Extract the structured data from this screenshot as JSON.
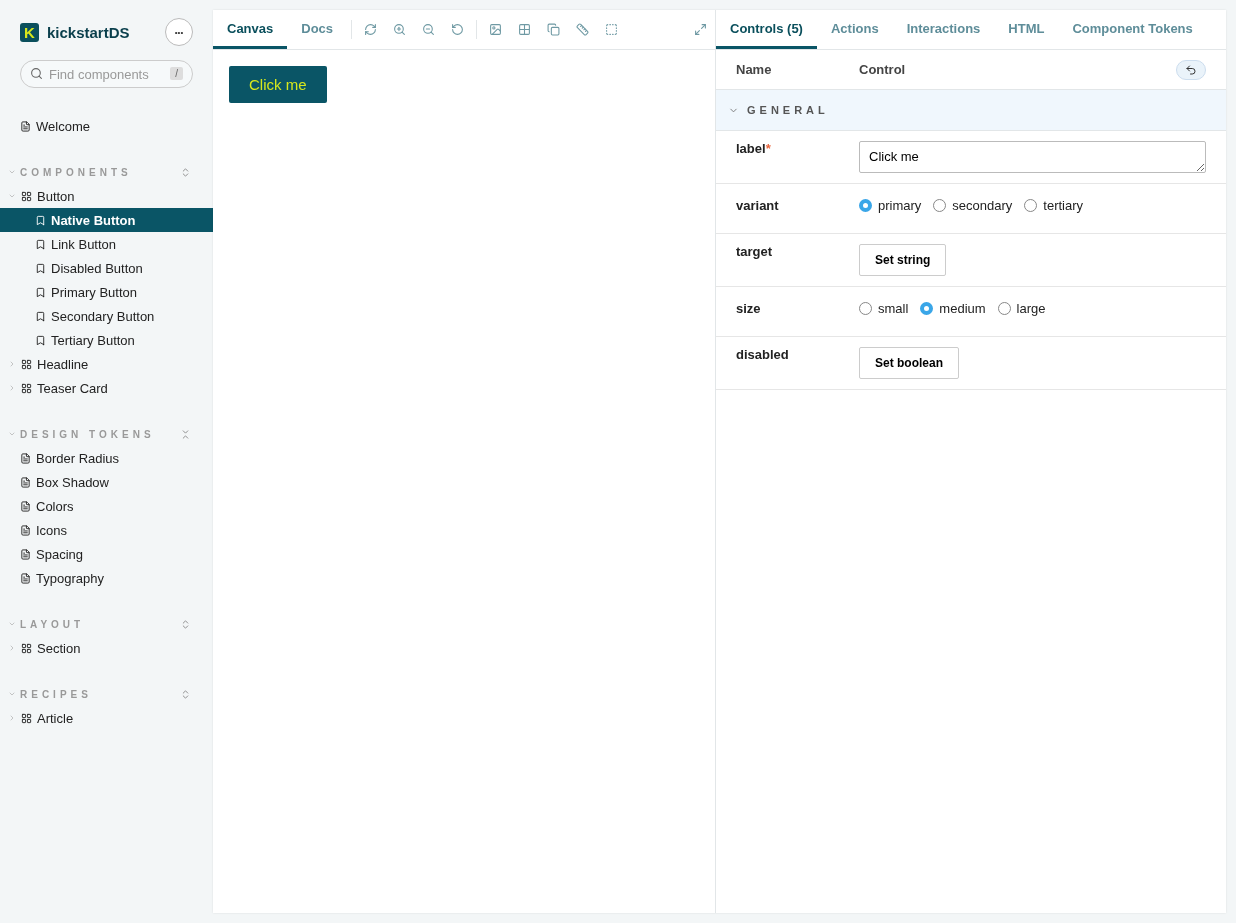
{
  "sidebar": {
    "logo_mark": "K",
    "brand": "kickstartDS",
    "menu_button": "•••",
    "search": {
      "placeholder": "Find components",
      "shortcut": "/"
    },
    "top_items": [
      {
        "label": "Welcome",
        "kind": "doc",
        "selected": false
      }
    ],
    "sections": [
      {
        "title": "COMPONENTS",
        "expanded": true,
        "all_expanded": false,
        "items": [
          {
            "label": "Button",
            "kind": "component",
            "expanded": true,
            "selected": false,
            "children": [
              {
                "label": "Native Button",
                "kind": "story",
                "selected": true
              },
              {
                "label": "Link Button",
                "kind": "story",
                "selected": false
              },
              {
                "label": "Disabled Button",
                "kind": "story",
                "selected": false
              },
              {
                "label": "Primary Button",
                "kind": "story",
                "selected": false
              },
              {
                "label": "Secondary Button",
                "kind": "story",
                "selected": false
              },
              {
                "label": "Tertiary Button",
                "kind": "story",
                "selected": false
              }
            ]
          },
          {
            "label": "Headline",
            "kind": "component",
            "expanded": false,
            "selected": false
          },
          {
            "label": "Teaser Card",
            "kind": "component",
            "expanded": false,
            "selected": false
          }
        ]
      },
      {
        "title": "DESIGN TOKENS",
        "expanded": true,
        "all_expanded": true,
        "items": [
          {
            "label": "Border Radius",
            "kind": "doc",
            "selected": false
          },
          {
            "label": "Box Shadow",
            "kind": "doc",
            "selected": false
          },
          {
            "label": "Colors",
            "kind": "doc",
            "selected": false
          },
          {
            "label": "Icons",
            "kind": "doc",
            "selected": false
          },
          {
            "label": "Spacing",
            "kind": "doc",
            "selected": false
          },
          {
            "label": "Typography",
            "kind": "doc",
            "selected": false
          }
        ]
      },
      {
        "title": "LAYOUT",
        "expanded": true,
        "all_expanded": false,
        "items": [
          {
            "label": "Section",
            "kind": "component",
            "expanded": false,
            "selected": false
          }
        ]
      },
      {
        "title": "RECIPES",
        "expanded": true,
        "all_expanded": false,
        "items": [
          {
            "label": "Article",
            "kind": "component",
            "expanded": false,
            "selected": false
          }
        ]
      }
    ]
  },
  "canvas": {
    "tabs": [
      {
        "label": "Canvas",
        "selected": true
      },
      {
        "label": "Docs",
        "selected": false
      }
    ],
    "preview_button": "Click me"
  },
  "addons": {
    "tabs": [
      {
        "label": "Controls (5)",
        "selected": true
      },
      {
        "label": "Actions",
        "selected": false
      },
      {
        "label": "Interactions",
        "selected": false
      },
      {
        "label": "HTML",
        "selected": false
      },
      {
        "label": "Component Tokens",
        "selected": false
      }
    ],
    "columns": [
      "Name",
      "Control"
    ],
    "group": {
      "title": "GENERAL",
      "expanded": true
    },
    "rows": [
      {
        "name": "label",
        "required": true,
        "required_mark": "*",
        "kind": "text",
        "value": "Click me"
      },
      {
        "name": "variant",
        "required": false,
        "kind": "radio",
        "options": [
          {
            "label": "primary",
            "selected": true
          },
          {
            "label": "secondary",
            "selected": false
          },
          {
            "label": "tertiary",
            "selected": false
          }
        ]
      },
      {
        "name": "target",
        "required": false,
        "kind": "button",
        "button": "Set string"
      },
      {
        "name": "size",
        "required": false,
        "kind": "radio",
        "options": [
          {
            "label": "small",
            "selected": false
          },
          {
            "label": "medium",
            "selected": true
          },
          {
            "label": "large",
            "selected": false
          }
        ]
      },
      {
        "name": "disabled",
        "required": false,
        "kind": "button",
        "button": "Set boolean"
      }
    ]
  }
}
